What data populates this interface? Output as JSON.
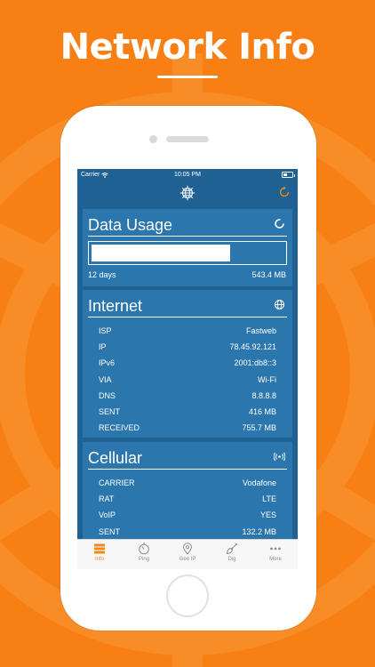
{
  "headline": "Network Info",
  "status_bar": {
    "carrier": "Carrier",
    "time": "10:05 PM"
  },
  "data_usage": {
    "title": "Data Usage",
    "usage_fraction": 0.72,
    "days": "12 days",
    "total": "543.4 MB"
  },
  "internet": {
    "title": "Internet",
    "rows": [
      {
        "key": "ISP",
        "value": "Fastweb"
      },
      {
        "key": "IP",
        "value": "78.45.92.121"
      },
      {
        "key": "IPv6",
        "value": "2001:db8::3"
      },
      {
        "key": "VIA",
        "value": "Wi-Fi"
      },
      {
        "key": "DNS",
        "value": "8.8.8.8"
      },
      {
        "key": "SENT",
        "value": "416 MB"
      },
      {
        "key": "RECEIVED",
        "value": "755.7 MB"
      }
    ]
  },
  "cellular": {
    "title": "Cellular",
    "rows": [
      {
        "key": "CARRIER",
        "value": "Vodafone"
      },
      {
        "key": "RAT",
        "value": "LTE"
      },
      {
        "key": "VoIP",
        "value": "YES"
      },
      {
        "key": "SENT",
        "value": "132.2 MB"
      }
    ]
  },
  "tabs": [
    {
      "label": "Info",
      "icon": "server-icon",
      "active": true
    },
    {
      "label": "Ping",
      "icon": "stopwatch-icon",
      "active": false
    },
    {
      "label": "Geo IP",
      "icon": "location-pin-icon",
      "active": false
    },
    {
      "label": "Dig",
      "icon": "shovel-icon",
      "active": false
    },
    {
      "label": "More",
      "icon": "more-dots-icon",
      "active": false
    }
  ],
  "colors": {
    "background": "#f77f14",
    "screen": "#1f6193",
    "card": "#2a76ad",
    "accent": "#f08a1d"
  }
}
